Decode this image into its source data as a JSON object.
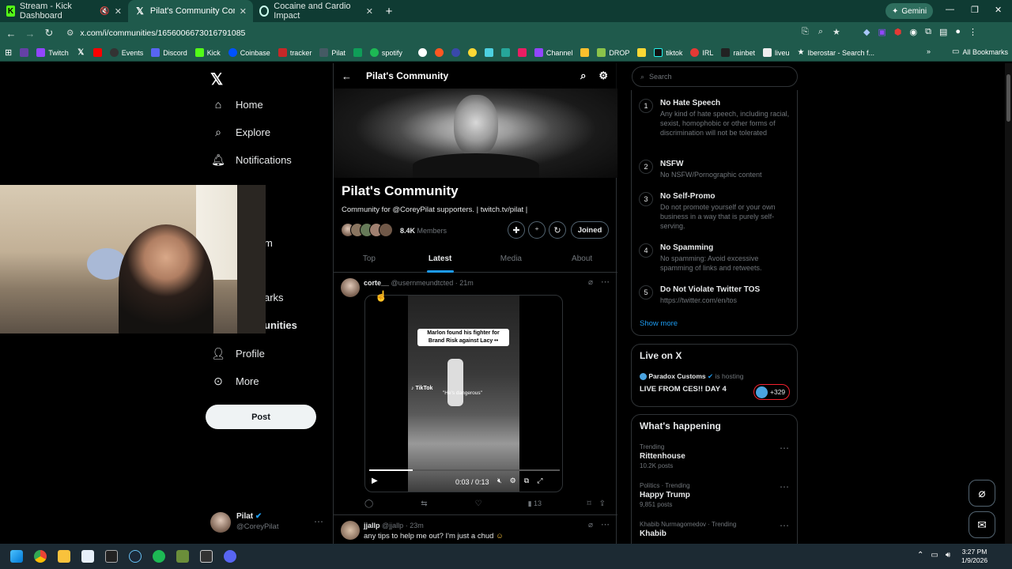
{
  "browser": {
    "tabs": [
      {
        "title": "Stream - Kick Dashboard"
      },
      {
        "title": "Pilat's Community Community"
      },
      {
        "title": "Cocaine and Cardio Impact"
      }
    ],
    "url": "x.com/i/communities/1656006673016791085",
    "gemini_label": "Gemini",
    "bookmarks": [
      "Twitch",
      "Events",
      "Discord",
      "Kick",
      "Coinbase",
      "tracker",
      "Pilat",
      "spotify",
      "Channel",
      "DROP",
      "tiktok",
      "IRL",
      "rainbet",
      "liveu",
      "Iberostar - Search f..."
    ],
    "all_bookmarks": "All Bookmarks"
  },
  "nav": {
    "home": "Home",
    "explore": "Explore",
    "notifications": "Notifications",
    "partial_1": "m",
    "bookmarks_partial": "arks",
    "communities_partial": "unities",
    "profile": "Profile",
    "more": "More",
    "post": "Post",
    "user_name": "Pilat",
    "user_handle": "@CoreyPilat"
  },
  "community": {
    "header": "Pilat's Community",
    "name": "Pilat's Community",
    "desc": "Community for @CoreyPilat supporters. | twitch.tv/pilat |",
    "members_count": "8.4K",
    "members_label": "Members",
    "joined": "Joined",
    "tabs": [
      "Top",
      "Latest",
      "Media",
      "About"
    ]
  },
  "post1": {
    "name": "corte__",
    "handle": "@usernmeundtcted",
    "time": "· 21m",
    "caption_line1": "Marlon found his fighter for",
    "caption_line2": "Brand Risk against Lacy ••",
    "tiktok": "TikTok",
    "quote": "\"He's dangerous\"",
    "time_display": "0:03 / 0:13",
    "views": "13"
  },
  "post2": {
    "name": "jjallp",
    "handle": "@jjallp",
    "time": "· 23m",
    "text": "any tips to help me out? I'm just a chud"
  },
  "search_placeholder": "Search",
  "rules": [
    {
      "n": "1",
      "title": "No Hate Speech",
      "body": "Any kind of hate speech, including racial, sexist, homophobic or other forms of discrimination will not be tolerated"
    },
    {
      "n": "2",
      "title": "NSFW",
      "body": "No NSFW/Pornographic content"
    },
    {
      "n": "3",
      "title": "No Self-Promo",
      "body": "Do not promote yourself or your own business in a way that is purely self-serving."
    },
    {
      "n": "4",
      "title": "No Spamming",
      "body": "No spamming: Avoid excessive spamming of links and retweets."
    },
    {
      "n": "5",
      "title": "Do Not Violate Twitter TOS",
      "body": "https://twitter.com/en/tos"
    }
  ],
  "show_more": "Show more",
  "live": {
    "heading": "Live on X",
    "host": "Paradox Customs",
    "hosting": "is hosting",
    "title": "LIVE FROM CES!! DAY 4",
    "count": "+329"
  },
  "happening": {
    "heading": "What's happening",
    "items": [
      {
        "context": "Trending",
        "topic": "Rittenhouse",
        "posts": "10.2K posts"
      },
      {
        "context": "Politics · Trending",
        "topic": "Happy Trump",
        "posts": "9,851 posts"
      },
      {
        "context": "Khabib Nurmagomedov · Trending",
        "topic": "Khabib",
        "posts": ""
      }
    ]
  },
  "clock": {
    "time": "3:27 PM",
    "date": "1/9/2026"
  },
  "colors": {
    "accent": "#1d9bf0",
    "browser_frame": "#1f5a4c",
    "kick_green": "#53fc18"
  }
}
